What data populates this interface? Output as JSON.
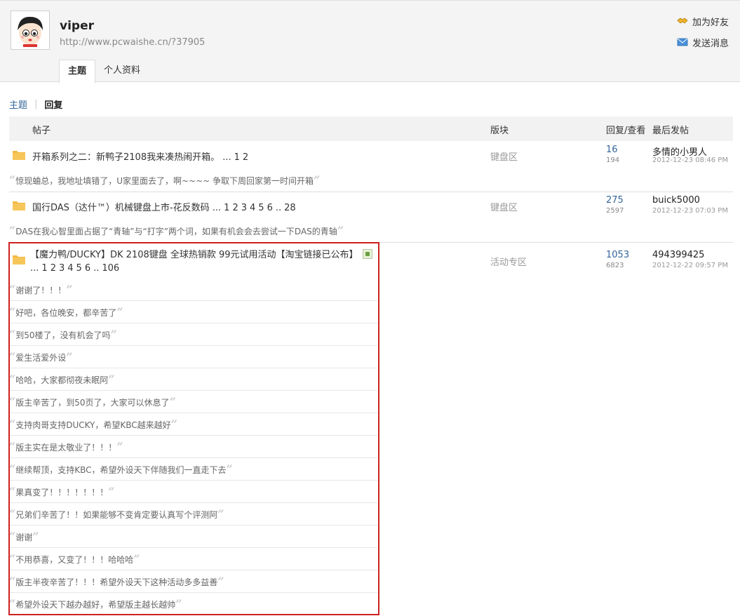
{
  "profile": {
    "username": "viper",
    "url": "http://www.pcwaishe.cn/?37905",
    "add_friend": "加为好友",
    "send_message": "发送消息"
  },
  "tabs": [
    "主题",
    "个人资料"
  ],
  "subnav": {
    "topics": "主题",
    "replies": "回复"
  },
  "table": {
    "headers": {
      "post": "帖子",
      "forum": "版块",
      "reply_view": "回复/查看",
      "last_post": "最后发帖"
    }
  },
  "threads": [
    {
      "title": "开箱系列之二：新鸭子2108我来凑热闹开箱。",
      "pages_prefix": "...",
      "pages": [
        "1",
        "2"
      ],
      "forum": "键盘区",
      "replies": "16",
      "views": "194",
      "last_user": "多情的小男人",
      "last_date": "2012-12-23 08:46 PM",
      "quotes": [
        "惊现蛐总，我地址填错了，U家里面去了，啊~~~~ 争取下周回家第一时间开箱"
      ]
    },
    {
      "title": "国行DAS（达什™）机械键盘上市-花反数码",
      "pages_prefix": "...",
      "pages": [
        "1",
        "2",
        "3",
        "4",
        "5",
        "6",
        "..",
        "28"
      ],
      "forum": "键盘区",
      "replies": "275",
      "views": "2597",
      "last_user": "buick5000",
      "last_date": "2012-12-23 07:03 PM",
      "quotes": [
        "DAS在我心智里面占据了“青轴”与“打字”两个词，如果有机会会去尝试一下DAS的青轴"
      ]
    },
    {
      "title": "【魔力鸭/DUCKY】DK 2108键盘 全球热销款 99元试用活动【淘宝链接已公布】",
      "pages_prefix": "...",
      "pages": [
        "1",
        "2",
        "3",
        "4",
        "5",
        "6",
        "..",
        "106"
      ],
      "forum": "活动专区",
      "replies": "1053",
      "views": "6823",
      "last_user": "494399425",
      "last_date": "2012-12-22 09:57 PM",
      "quotes": [
        "谢谢了！！！",
        "好吧，各位晚安，都辛苦了",
        "到50楼了，没有机会了吗",
        "爱生活爱外设",
        "哈哈，大家都彻夜未眠阿",
        "版主辛苦了，到50页了，大家可以休息了",
        "支持肉哥支持DUCKY，希望KBC越来越好",
        "版主实在是太敬业了！！！",
        "继续帮顶，支持KBC，希望外设天下伴随我们一直走下去",
        "果真变了！！！！！！！",
        "兄弟们辛苦了！！如果能够不变肯定要认真写个评测阿",
        "谢谢",
        "不用恭喜，又变了！！！哈哈哈",
        "版主半夜辛苦了！！！希望外设天下这种活动多多益善",
        "希望外设天下越办越好，希望版主越长越帅"
      ]
    }
  ],
  "colors": {
    "link": "#336699",
    "highlight_border": "#cc2222",
    "folder": "#f4b942"
  },
  "icons": {
    "folder": "folder-icon",
    "image": "image-attachment-icon",
    "handshake": "handshake-icon",
    "envelope": "envelope-icon"
  }
}
